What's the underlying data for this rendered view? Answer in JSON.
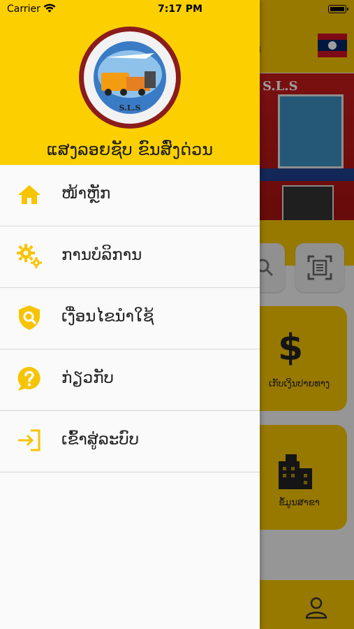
{
  "status_bar": {
    "carrier": "Carrier",
    "time": "7:17 PM"
  },
  "drawer": {
    "brand_title": "ແສງລອຍຊັບ ຂົນສົ່ງດ່ວນ",
    "logo_text": "S.L.S",
    "menu": [
      {
        "label": "ໜ້າຫຼັກ",
        "icon": "home-icon"
      },
      {
        "label": "ການບໍລິການ",
        "icon": "gears-icon"
      },
      {
        "label": "ເງື່ອນໄຂນຳໃຊ້",
        "icon": "shield-search-icon"
      },
      {
        "label": "ກ່ຽວກັບ",
        "icon": "help-icon"
      },
      {
        "label": "ເຂົ້າສູ່ລະບົບ",
        "icon": "login-icon"
      }
    ]
  },
  "background": {
    "header_partial_text": "ມ",
    "building_sign": "S.L.S",
    "cards": [
      {
        "label": "ເກັບເງິນປາຍທາງ",
        "icon": "dollar-icon"
      },
      {
        "label": "ຂໍ້ມູນສາຂາ",
        "icon": "building-icon"
      }
    ]
  },
  "colors": {
    "brand_yellow": "#fcd000",
    "icon_yellow": "#f6c400"
  }
}
